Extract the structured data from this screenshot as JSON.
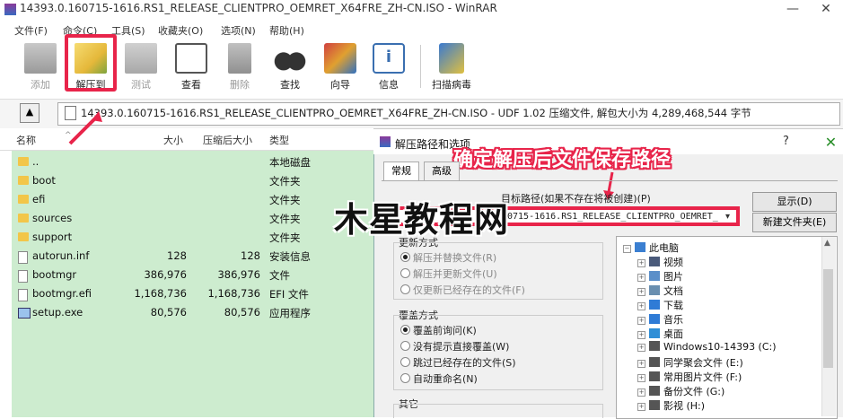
{
  "window": {
    "title": "14393.0.160715-1616.RS1_RELEASE_CLIENTPRO_OEMRET_X64FRE_ZH-CN.ISO - WinRAR",
    "minimize_label": "—",
    "close_label": "✕"
  },
  "menu": [
    "文件(F)",
    "命令(C)",
    "工具(S)",
    "收藏夹(O)",
    "选项(N)",
    "帮助(H)"
  ],
  "toolbar": {
    "add": "添加",
    "extract": "解压到",
    "test": "测试",
    "view": "查看",
    "delete": "删除",
    "find": "查找",
    "wizard": "向导",
    "info": "信息",
    "scan": "扫描病毒"
  },
  "address": {
    "up_icon": "up-arrow-icon",
    "path": "14393.0.160715-1616.RS1_RELEASE_CLIENTPRO_OEMRET_X64FRE_ZH-CN.ISO - UDF 1.02 压缩文件, 解包大小为 4,289,468,544 字节"
  },
  "file_list": {
    "headers": {
      "name": "名称",
      "size": "大小",
      "packed": "压缩后大小",
      "type": "类型"
    },
    "rows": [
      {
        "name": "..",
        "size": "",
        "packed": "",
        "type": "本地磁盘",
        "icon": "folder"
      },
      {
        "name": "boot",
        "size": "",
        "packed": "",
        "type": "文件夹",
        "icon": "folder"
      },
      {
        "name": "efi",
        "size": "",
        "packed": "",
        "type": "文件夹",
        "icon": "folder"
      },
      {
        "name": "sources",
        "size": "",
        "packed": "",
        "type": "文件夹",
        "icon": "folder"
      },
      {
        "name": "support",
        "size": "",
        "packed": "",
        "type": "文件夹",
        "icon": "folder"
      },
      {
        "name": "autorun.inf",
        "size": "128",
        "packed": "128",
        "type": "安装信息",
        "icon": "file"
      },
      {
        "name": "bootmgr",
        "size": "386,976",
        "packed": "386,976",
        "type": "文件",
        "icon": "file"
      },
      {
        "name": "bootmgr.efi",
        "size": "1,168,736",
        "packed": "1,168,736",
        "type": "EFI 文件",
        "icon": "file"
      },
      {
        "name": "setup.exe",
        "size": "80,576",
        "packed": "80,576",
        "type": "应用程序",
        "icon": "exe"
      }
    ]
  },
  "dialog": {
    "title": "解压路径和选项",
    "help": "?",
    "close": "✕",
    "tabs": [
      "常规",
      "高级"
    ],
    "annotation": "确定解压后文件保存路径",
    "dest_label": "目标路径(如果不存在将被创建)(P)",
    "dest_value": "0715-1616.RS1_RELEASE_CLIENTPRO_OEMRET_",
    "show_button": "显示(D)",
    "new_folder_button": "新建文件夹(E)",
    "update_mode": {
      "title": "更新方式",
      "options": [
        "解压并替换文件(R)",
        "解压并更新文件(U)",
        "仅更新已经存在的文件(F)"
      ]
    },
    "overwrite_mode": {
      "title": "覆盖方式",
      "options": [
        "覆盖前询问(K)",
        "没有提示直接覆盖(W)",
        "跳过已经存在的文件(S)",
        "自动重命名(N)"
      ]
    },
    "misc": {
      "title": "其它"
    },
    "tree": [
      {
        "label": "此电脑",
        "icon": "computer-icon",
        "color": "#3b7fd1"
      },
      {
        "label": "视频",
        "icon": "video-icon",
        "color": "#4a5a7a"
      },
      {
        "label": "图片",
        "icon": "pictures-icon",
        "color": "#5b8fc9"
      },
      {
        "label": "文档",
        "icon": "documents-icon",
        "color": "#6a8fb0"
      },
      {
        "label": "下载",
        "icon": "downloads-icon",
        "color": "#2f7bd6"
      },
      {
        "label": "音乐",
        "icon": "music-icon",
        "color": "#2f7bd6"
      },
      {
        "label": "桌面",
        "icon": "desktop-icon",
        "color": "#2f8ed6"
      },
      {
        "label": "Windows10-14393 (C:)",
        "icon": "drive-icon",
        "color": "#555"
      },
      {
        "label": "同学聚会文件 (E:)",
        "icon": "drive-icon",
        "color": "#555"
      },
      {
        "label": "常用图片文件 (F:)",
        "icon": "drive-icon",
        "color": "#555"
      },
      {
        "label": "备份文件 (G:)",
        "icon": "drive-icon",
        "color": "#555"
      },
      {
        "label": "影视 (H:)",
        "icon": "drive-icon",
        "color": "#555"
      }
    ]
  },
  "watermark": "木星教程网",
  "colors": {
    "highlight": "#e8244a",
    "list_bg": "#cdeccf",
    "folder": "#f2c649"
  }
}
